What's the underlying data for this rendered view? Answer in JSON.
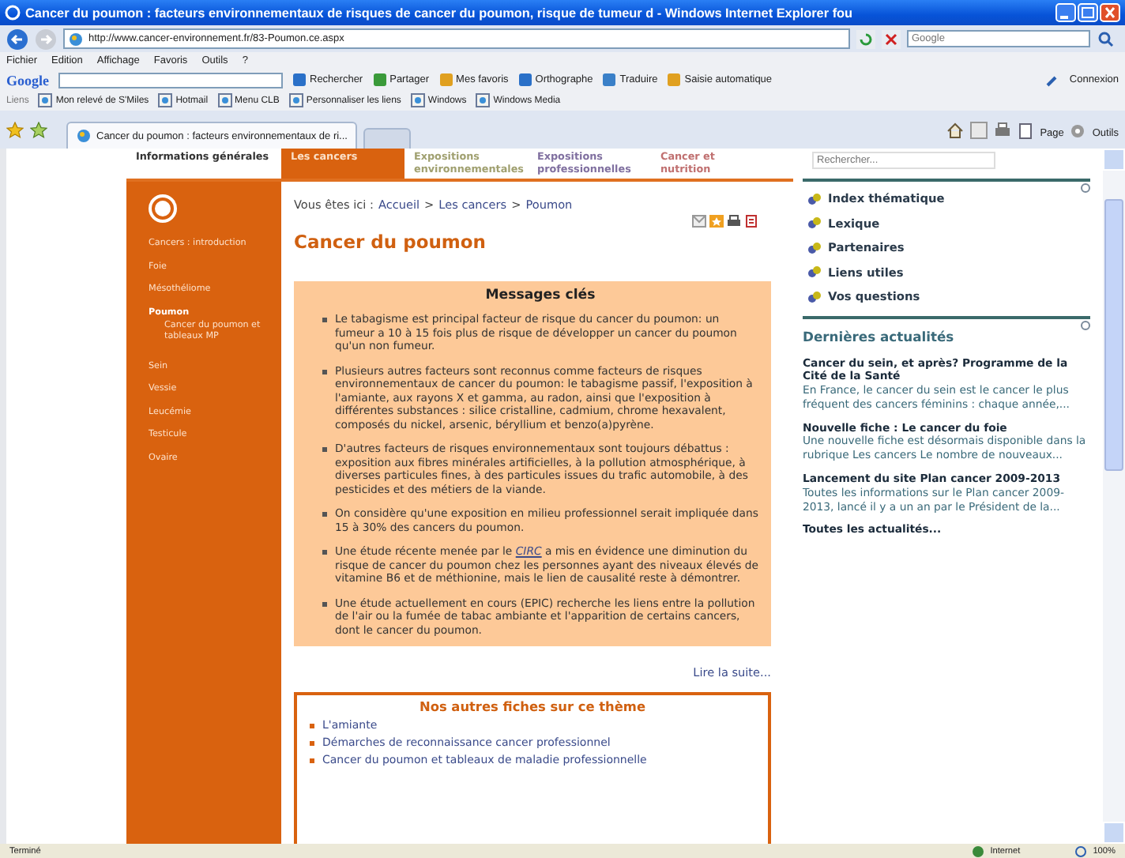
{
  "window": {
    "title": "Cancer du poumon : facteurs environnementaux de risques de cancer du poumon, risque de tumeur d - Windows Internet Explorer fou"
  },
  "address_bar": {
    "url": "http://www.cancer-environnement.fr/83-Poumon.ce.aspx",
    "search_placeholder": "Google"
  },
  "menu_bar": [
    "Fichier",
    "Edition",
    "Affichage",
    "Favoris",
    "Outils",
    "?"
  ],
  "google_toolbar": {
    "logo": "Google",
    "items": [
      "Rechercher",
      "Partager",
      "Mes favoris",
      "Orthographe",
      "Traduire",
      "Saisie automatique"
    ],
    "signin": "Connexion"
  },
  "links_bar": {
    "label": "Liens",
    "links": [
      "Mon relevé de S'Miles",
      "Hotmail",
      "Menu CLB",
      "Personnaliser les liens",
      "Windows",
      "Windows Media"
    ]
  },
  "tab_bar": {
    "tabs": [
      {
        "label": "Cancer du poumon : facteurs environnementaux de ri...",
        "selected": true
      }
    ],
    "tools": [
      "Page",
      "Outils"
    ]
  },
  "site_nav": [
    {
      "label": "Informations générales",
      "selected": false
    },
    {
      "label": "Les cancers",
      "selected": true
    },
    {
      "label": "Expositions environnementales",
      "selected": false
    },
    {
      "label": "Expositions professionnelles",
      "selected": false
    },
    {
      "label": "Cancer et nutrition",
      "selected": false
    }
  ],
  "sidebar": {
    "items": [
      {
        "label": "Cancers : introduction",
        "selected": false
      },
      {
        "label": "Foie",
        "selected": false
      },
      {
        "label": "Mésothéliome",
        "selected": false
      },
      {
        "label": "Poumon",
        "selected": true,
        "children": [
          {
            "label": "Cancer du poumon et tableaux MP",
            "selected": false
          }
        ]
      },
      {
        "label": "Sein",
        "selected": false
      },
      {
        "label": "Vessie",
        "selected": false
      },
      {
        "label": "Leucémie",
        "selected": false
      },
      {
        "label": "Testicule",
        "selected": false
      },
      {
        "label": "Ovaire",
        "selected": false
      }
    ]
  },
  "breadcrumb": {
    "prefix": "Vous êtes ici :",
    "separator": ">",
    "items": [
      "Accueil",
      "Les cancers",
      "Poumon"
    ]
  },
  "page_title": "Cancer du poumon",
  "key_messages": {
    "title": "Messages clés",
    "bullets": [
      {
        "text": "Le tabagisme est principal facteur de risque du cancer du poumon: un fumeur a 10 à 15 fois plus de risque de développer un cancer du poumon qu'un non fumeur."
      },
      {
        "text": "Plusieurs autres facteurs sont reconnus comme facteurs de risques environnementaux de cancer du poumon: le tabagisme passif, l'exposition à l'amiante, aux rayons X et gamma, au radon, ainsi que l'exposition à différentes substances : silice cristalline, cadmium, chrome hexavalent, composés du nickel, arsenic, béryllium et benzo(a)pyrène."
      },
      {
        "text": "D'autres facteurs de risques environnementaux sont toujours débattus : exposition aux fibres minérales artificielles, à la pollution atmosphérique, à diverses particules fines, à des particules issues du trafic automobile, à des pesticides et des métiers de la viande."
      },
      {
        "text": "On considère qu'une exposition en milieu professionnel serait impliquée dans 15 à 30% des cancers du poumon."
      },
      {
        "text": "Une étude récente menée par le",
        "link": "CIRC",
        "after": "a mis en évidence une diminution du risque de cancer du poumon chez les personnes ayant des niveaux élevés de vitamine B6 et de méthionine, mais le lien de causalité reste à démontrer."
      },
      {
        "text": "Une étude actuellement en cours (EPIC) recherche les liens entre la pollution de l'air ou la fumée de tabac ambiante et l'apparition de certains cancers, dont le cancer du poumon."
      }
    ]
  },
  "read_more": "Lire la suite...",
  "other_sheets": {
    "title": "Nos autres fiches sur ce thème",
    "links": [
      "L'amiante",
      "Démarches de reconnaissance cancer professionnel",
      "Cancer du poumon et tableaux de maladie professionnelle"
    ]
  },
  "right_column": {
    "search_placeholder": "Rechercher...",
    "links": [
      "Index thématique",
      "Lexique",
      "Partenaires",
      "Liens utiles",
      "Vos questions"
    ],
    "news_title": "Dernières actualités",
    "news": [
      {
        "title": "Cancer du sein, et après? Programme de la Cité de la Santé",
        "summary": "En France, le cancer du sein est le cancer le plus fréquent des cancers féminins : chaque année,..."
      },
      {
        "title": "Nouvelle fiche : Le cancer du foie",
        "summary": "Une nouvelle fiche est désormais disponible dans la rubrique Les cancers Le nombre de nouveaux..."
      },
      {
        "title": "Lancement du site Plan cancer 2009-2013",
        "summary": "Toutes les informations sur le Plan cancer 2009-2013, lancé il y a un an par le Président de la..."
      }
    ],
    "all_news": "Toutes les actualités..."
  },
  "status_bar": {
    "status": "Terminé",
    "zone": "Internet",
    "zoom": "100%"
  }
}
